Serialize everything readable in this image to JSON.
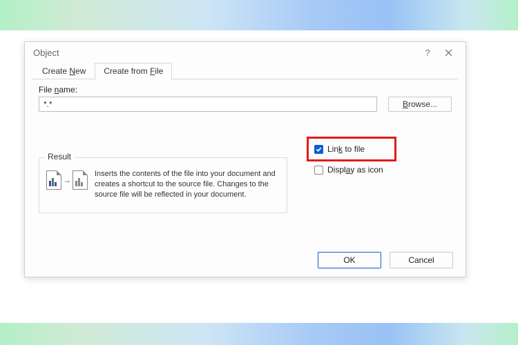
{
  "dialog": {
    "title": "Object",
    "tabs": {
      "create_new": "Create New",
      "create_from_file": "Create from File"
    },
    "file_label": "File name:",
    "file_value": "*.*",
    "browse": "Browse...",
    "link_to_file": "Link to file",
    "display_as_icon": "Display as icon",
    "result_legend": "Result",
    "result_text": "Inserts the contents of the file into your document and creates a shortcut to the source file.  Changes to the source file will be reflected in your document.",
    "ok": "OK",
    "cancel": "Cancel",
    "help": "?"
  }
}
